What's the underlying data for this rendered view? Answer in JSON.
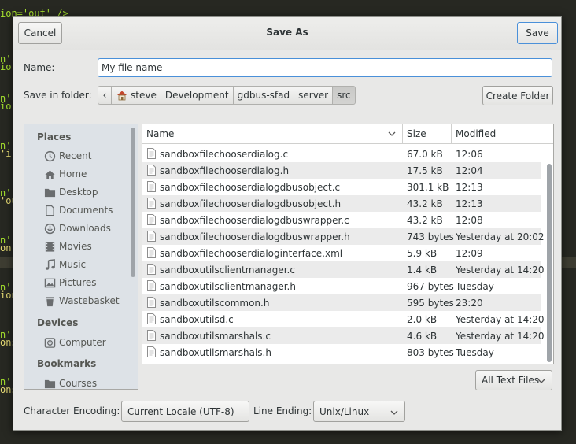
{
  "background_editor": {
    "lines": [
      {
        "text": "ion='out' />",
        "class": "g"
      },
      {
        "text": "n'",
        "class": "g"
      },
      {
        "text": "io",
        "class": "g"
      },
      {
        "text": "n'",
        "class": "g"
      },
      {
        "text": "io",
        "class": "g"
      },
      {
        "text": "n'",
        "class": "g"
      },
      {
        "text": "'i",
        "class": "y"
      },
      {
        "text": "n'",
        "class": "g"
      },
      {
        "text": "'ou",
        "class": "y"
      },
      {
        "text": "n'",
        "class": "g"
      },
      {
        "text": "on",
        "class": "y"
      },
      {
        "text": "n'",
        "class": "g"
      },
      {
        "text": "ion",
        "class": "y"
      },
      {
        "text": "n'",
        "class": "g"
      },
      {
        "text": "ons",
        "class": "y"
      },
      {
        "text": "n'",
        "class": "g"
      },
      {
        "text": "ons",
        "class": "y"
      }
    ]
  },
  "dialog": {
    "title": "Save As",
    "cancel_label": "Cancel",
    "save_label": "Save",
    "name_label": "Name:",
    "name_value": "My file name",
    "folder_label": "Save in folder:",
    "path": [
      "steve",
      "Development",
      "gdbus-sfad",
      "server",
      "src"
    ],
    "path_back": "‹",
    "create_folder_label": "Create Folder",
    "sidebar": {
      "places_heading": "Places",
      "places": [
        {
          "label": "Recent",
          "icon": "clock-icon"
        },
        {
          "label": "Home",
          "icon": "home-icon"
        },
        {
          "label": "Desktop",
          "icon": "folder-icon"
        },
        {
          "label": "Documents",
          "icon": "document-icon"
        },
        {
          "label": "Downloads",
          "icon": "download-icon"
        },
        {
          "label": "Movies",
          "icon": "film-icon"
        },
        {
          "label": "Music",
          "icon": "music-note-icon"
        },
        {
          "label": "Pictures",
          "icon": "picture-icon"
        },
        {
          "label": "Wastebasket",
          "icon": "trash-icon"
        }
      ],
      "devices_heading": "Devices",
      "devices": [
        {
          "label": "Computer",
          "icon": "drive-icon"
        }
      ],
      "bookmarks_heading": "Bookmarks",
      "bookmarks": [
        {
          "label": "Courses",
          "icon": "folder-icon"
        }
      ]
    },
    "columns": {
      "name": "Name",
      "size": "Size",
      "modified": "Modified"
    },
    "files": [
      {
        "name": "sandboxfilechooserdialog.c",
        "size": "67.0 kB",
        "modified": "12:06"
      },
      {
        "name": "sandboxfilechooserdialog.h",
        "size": "17.5 kB",
        "modified": "12:04"
      },
      {
        "name": "sandboxfilechooserdialogdbusobject.c",
        "size": "301.1 kB",
        "modified": "12:13"
      },
      {
        "name": "sandboxfilechooserdialogdbusobject.h",
        "size": "43.2 kB",
        "modified": "12:13"
      },
      {
        "name": "sandboxfilechooserdialogdbuswrapper.c",
        "size": "43.2 kB",
        "modified": "12:08"
      },
      {
        "name": "sandboxfilechooserdialogdbuswrapper.h",
        "size": "743 bytes",
        "modified": "Yesterday at 20:02"
      },
      {
        "name": "sandboxfilechooserdialoginterface.xml",
        "size": "5.9 kB",
        "modified": "12:09"
      },
      {
        "name": "sandboxutilsclientmanager.c",
        "size": "1.4 kB",
        "modified": "Yesterday at 14:20"
      },
      {
        "name": "sandboxutilsclientmanager.h",
        "size": "967 bytes",
        "modified": "Tuesday"
      },
      {
        "name": "sandboxutilscommon.h",
        "size": "595 bytes",
        "modified": "23:20"
      },
      {
        "name": "sandboxutilsd.c",
        "size": "2.0 kB",
        "modified": "Yesterday at 14:20"
      },
      {
        "name": "sandboxutilsmarshals.c",
        "size": "4.6 kB",
        "modified": "Yesterday at 14:20"
      },
      {
        "name": "sandboxutilsmarshals.h",
        "size": "803 bytes",
        "modified": "Tuesday"
      }
    ],
    "filter_label": "All Text Files",
    "encoding_label": "Character Encoding:",
    "encoding_value": "Current Locale (UTF-8)",
    "line_ending_label": "Line Ending:",
    "line_ending_value": "Unix/Linux"
  }
}
